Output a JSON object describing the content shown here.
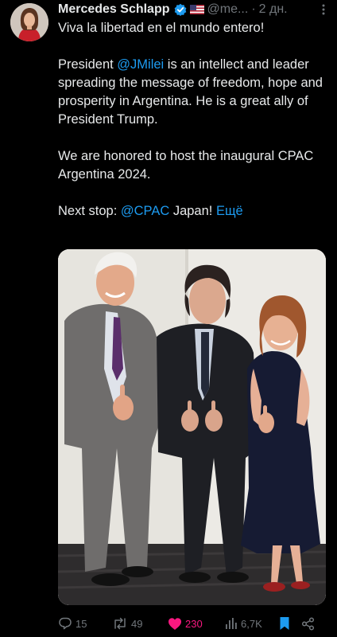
{
  "author": {
    "name": "Mercedes Schlapp",
    "handle": "@me...",
    "separator": "·",
    "time": "2 дн."
  },
  "tweet": {
    "line1": "Viva la libertad en el mundo entero!",
    "p2_part1": "President ",
    "p2_mention": "@JMilei",
    "p2_part2": " is an intellect and leader spreading the message of freedom, hope and prosperity in Argentina.  He is a great ally of President Trump.",
    "p3": "We are honored to host the inaugural CPAC Argentina 2024.",
    "p4_part1": "Next stop: ",
    "p4_mention": "@CPAC",
    "p4_part2": " Japan! ",
    "show_more": "Ещё"
  },
  "actions": {
    "replies": "15",
    "reposts": "49",
    "likes": "230",
    "views": "6,7K"
  },
  "icons": {
    "verified": "verified-badge-icon",
    "flag": "us-flag-icon",
    "more": "more-vertical-icon",
    "reply": "reply-icon",
    "repost": "repost-icon",
    "like": "heart-icon",
    "views": "views-icon",
    "bookmark": "bookmark-icon",
    "share": "share-icon"
  },
  "colors": {
    "background": "#000000",
    "text": "#e7e9ea",
    "muted": "#71767b",
    "link": "#1d9bf0",
    "like": "#f91880",
    "verified": "#1d9bf0"
  }
}
